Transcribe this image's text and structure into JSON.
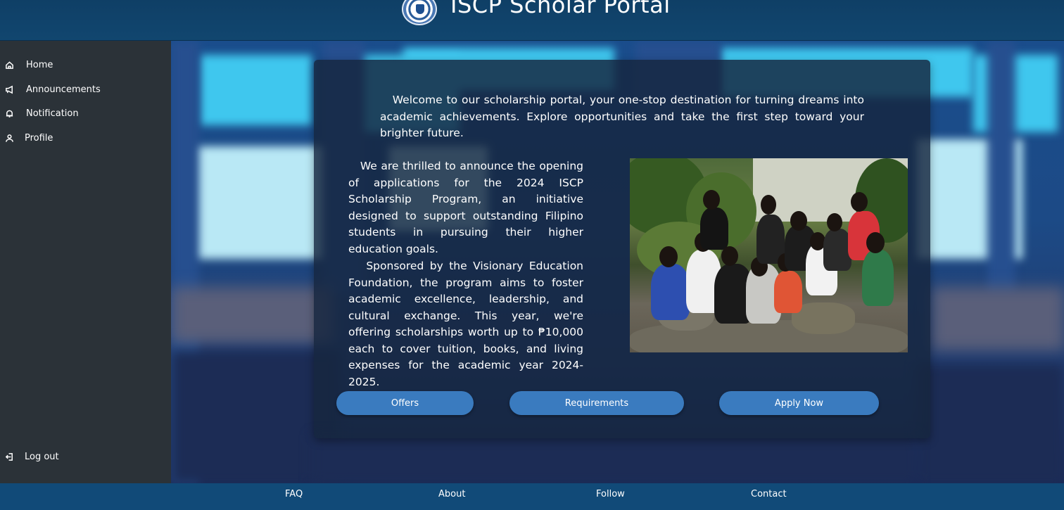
{
  "header": {
    "title": "ISCP Scholar Portal",
    "logo_icon": "school-seal-logo"
  },
  "sidebar": {
    "items": [
      {
        "label": "Home",
        "icon": "home-icon"
      },
      {
        "label": "Announcements",
        "icon": "megaphone-icon"
      },
      {
        "label": "Notification",
        "icon": "bell-icon"
      },
      {
        "label": "Profile",
        "icon": "user-icon"
      }
    ],
    "logout": {
      "label": "Log out",
      "icon": "logout-icon"
    }
  },
  "main": {
    "intro": "Welcome to our scholarship portal, your one-stop destination for turning dreams into academic achievements. Explore opportunities and take the first step toward your brighter future.",
    "paragraph1": "We are thrilled to announce the opening of applications for the 2024 ISCP Scholarship Program, an initiative designed to support outstanding Filipino students in pursuing their higher education goals.",
    "paragraph2": "Sponsored by the Visionary Education Foundation, the program aims to foster academic excellence, leadership, and cultural exchange. This year, we're offering scholarships worth up to ₱10,000 each to cover tuition, books, and living expenses for the academic year 2024-2025.",
    "buttons": {
      "offers": "Offers",
      "requirements": "Requirements",
      "apply": "Apply Now"
    }
  },
  "footer": {
    "links": [
      "FAQ",
      "About",
      "Follow",
      "Contact"
    ]
  },
  "colors": {
    "header": "#114a78",
    "sidebar": "#2b3238",
    "button": "#3a7bbf",
    "card": "#16263e"
  }
}
